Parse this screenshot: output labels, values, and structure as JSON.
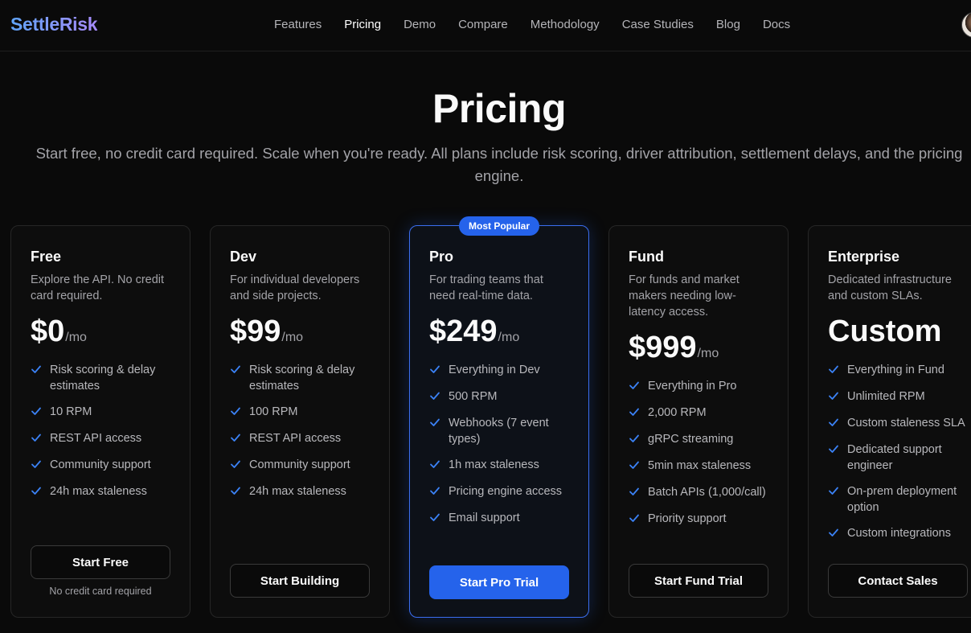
{
  "nav": {
    "logo": "SettleRisk",
    "links": [
      "Features",
      "Pricing",
      "Demo",
      "Compare",
      "Methodology",
      "Case Studies",
      "Blog",
      "Docs"
    ],
    "active": "Pricing"
  },
  "hero": {
    "title": "Pricing",
    "subtitle": "Start free, no credit card required. Scale when you're ready. All plans include risk scoring, driver attribution, settlement delays, and the pricing engine."
  },
  "plans": [
    {
      "name": "Free",
      "description": "Explore the API. No credit card required.",
      "price": "$0",
      "period": "/mo",
      "features": [
        "Risk scoring & delay estimates",
        "10 RPM",
        "REST API access",
        "Community support",
        "24h max staleness"
      ],
      "cta": "Start Free",
      "note": "No credit card required"
    },
    {
      "name": "Dev",
      "description": "For individual developers and side projects.",
      "price": "$99",
      "period": "/mo",
      "features": [
        "Risk scoring & delay estimates",
        "100 RPM",
        "REST API access",
        "Community support",
        "24h max staleness"
      ],
      "cta": "Start Building"
    },
    {
      "name": "Pro",
      "badge": "Most Popular",
      "description": "For trading teams that need real-time data.",
      "price": "$249",
      "period": "/mo",
      "features": [
        "Everything in Dev",
        "500 RPM",
        "Webhooks (7 event types)",
        "1h max staleness",
        "Pricing engine access",
        "Email support"
      ],
      "cta": "Start Pro Trial"
    },
    {
      "name": "Fund",
      "description": "For funds and market makers needing low-latency access.",
      "price": "$999",
      "period": "/mo",
      "features": [
        "Everything in Pro",
        "2,000 RPM",
        "gRPC streaming",
        "5min max staleness",
        "Batch APIs (1,000/call)",
        "Priority support"
      ],
      "cta": "Start Fund Trial"
    },
    {
      "name": "Enterprise",
      "description": "Dedicated infrastructure and custom SLAs.",
      "price": "Custom",
      "features": [
        "Everything in Fund",
        "Unlimited RPM",
        "Custom staleness SLA",
        "Dedicated support engineer",
        "On-prem deployment option",
        "Custom integrations"
      ],
      "cta": "Contact Sales"
    }
  ],
  "colors": {
    "background": "#0a0a0a",
    "accent": "#2563eb",
    "check": "#3b82f6",
    "logo_gradient_start": "#60a5fa",
    "logo_gradient_end": "#a78bfa"
  }
}
